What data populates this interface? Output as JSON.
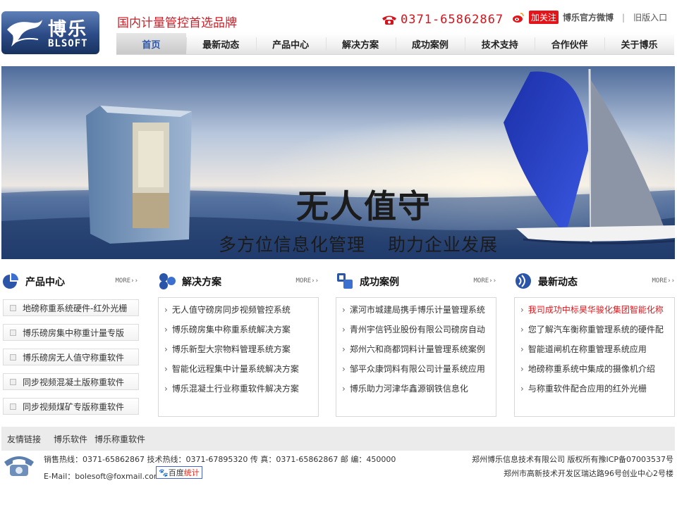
{
  "header": {
    "logo_cn": "博乐",
    "logo_en": "BLSOFT",
    "slogan": "国内计量管控首选品牌",
    "phone": "0371-65862867",
    "follow_label": "加关注",
    "weibo_label": "博乐官方微博",
    "separator": "|",
    "old_version_label": "旧版入口"
  },
  "nav": [
    {
      "label": "首页",
      "active": true
    },
    {
      "label": "最新动态"
    },
    {
      "label": "产品中心"
    },
    {
      "label": "解决方案"
    },
    {
      "label": "成功案例"
    },
    {
      "label": "技术支持"
    },
    {
      "label": "合作伙伴"
    },
    {
      "label": "关于博乐"
    }
  ],
  "banner": {
    "title": "无人值守",
    "subtitle_1": "多方位信息化管理",
    "subtitle_2": "助力企业发展"
  },
  "sections": {
    "products": {
      "title": "产品中心",
      "more": "MORE››",
      "items": [
        "地磅称重系统硬件-红外光栅",
        "博乐磅房集中称重计量专版",
        "博乐磅房无人值守称重软件",
        "同步视频混凝土版称重软件",
        "同步视频煤矿专版称重软件"
      ]
    },
    "solutions": {
      "title": "解决方案",
      "more": "MORE››",
      "items": [
        "无人值守磅房同步视频管控系统",
        "博乐磅房集中称重系统解决方案",
        "博乐新型大宗物料管理系统方案",
        "智能化远程集中计量系统解决方案",
        "博乐混凝土行业称重软件解决方案"
      ]
    },
    "cases": {
      "title": "成功案例",
      "more": "MORE››",
      "items": [
        "漯河市城建局携手博乐计量管理系统",
        "青州宇信钙业股份有限公司磅房自动",
        "郑州六和商都饲料计量管理系统案例",
        "邹平众康饲料有限公司计量系统应用",
        "博乐助力河津华鑫源钢铁信息化"
      ]
    },
    "news": {
      "title": "最新动态",
      "more": "MORE››",
      "items": [
        "我司成功中标昊华骏化集团智能化称",
        "您了解汽车衡称重管理系统的硬件配",
        "智能道闸机在称重管理系统应用",
        "地磅称重系统中集成的摄像机介绍",
        "与称重软件配合应用的红外光栅"
      ]
    }
  },
  "links": {
    "label": "友情链接",
    "items": [
      "博乐软件",
      "博乐称重软件"
    ]
  },
  "footer": {
    "contact_line": "销售热线：0371-65862867 技术热线：0371-67895320 传 真：0371-65862867 邮 编：450000",
    "email_line": "E-Mail：bolesoft@foxmail.com",
    "baidu_label": "百度",
    "baidu_stat": "统计",
    "copyright": "郑州博乐信息技术有限公司 版权所有豫ICP备07003537号",
    "address": "郑州市高新技术开发区瑞达路96号创业中心2号楼"
  },
  "colors": {
    "slogan": "#cc1f27",
    "phone": "#d4131c",
    "highlight_news": "#e3151b",
    "nav_active": "#2a55a8"
  }
}
